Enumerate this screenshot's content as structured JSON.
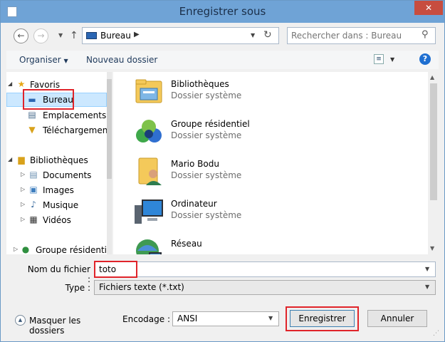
{
  "window": {
    "title": "Enregistrer sous",
    "close_symbol": "✕"
  },
  "address_bar": {
    "location": "Bureau",
    "search_placeholder": "Rechercher dans : Bureau"
  },
  "toolbar": {
    "organise_label": "Organiser",
    "new_folder_label": "Nouveau dossier",
    "help_symbol": "?"
  },
  "nav_pane": {
    "favorites": "Favoris",
    "desktop": "Bureau",
    "recent_places": "Emplacements ré",
    "downloads": "Téléchargements",
    "libraries": "Bibliothèques",
    "documents": "Documents",
    "pictures": "Images",
    "music": "Musique",
    "videos": "Vidéos",
    "homegroup": "Groupe résidentiel"
  },
  "files": [
    {
      "name": "Bibliothèques",
      "type": "Dossier système",
      "icon": "libraries-icon"
    },
    {
      "name": "Groupe résidentiel",
      "type": "Dossier système",
      "icon": "homegroup-icon"
    },
    {
      "name": "Mario Bodu",
      "type": "Dossier système",
      "icon": "user-folder-icon"
    },
    {
      "name": "Ordinateur",
      "type": "Dossier système",
      "icon": "computer-icon"
    },
    {
      "name": "Réseau",
      "type": "",
      "icon": "network-icon"
    }
  ],
  "form": {
    "filename_label": "Nom du fichier :",
    "filename_value": "toto",
    "filetype_label": "Type :",
    "filetype_value": "Fichiers texte (*.txt)",
    "encoding_label": "Encodage :",
    "encoding_value": "ANSI",
    "hide_folders_label": "Masquer les dossiers",
    "save_label": "Enregistrer",
    "cancel_label": "Annuler"
  },
  "colors": {
    "titlebar": "#6fa3d6",
    "close": "#c74d3f",
    "highlight": "#e0242a",
    "selection": "#cce8ff"
  }
}
